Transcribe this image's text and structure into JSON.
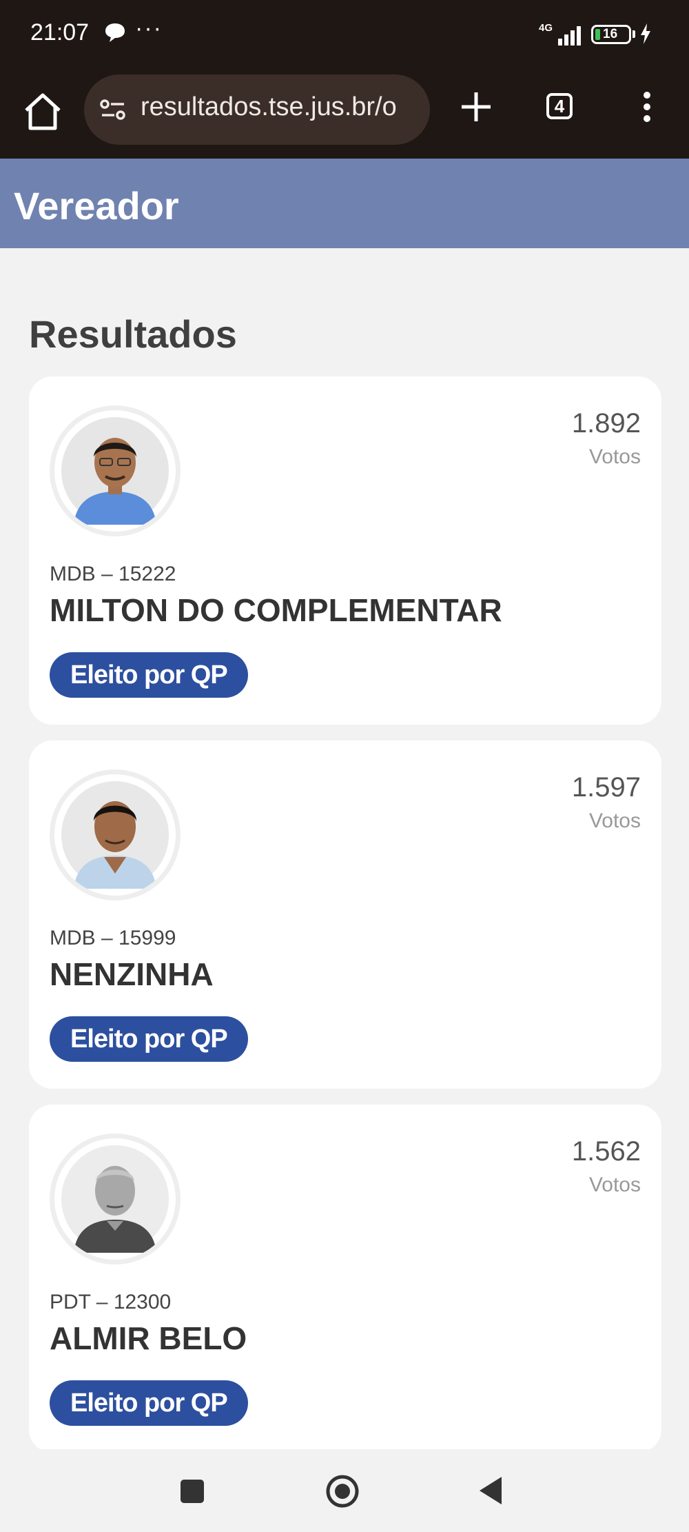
{
  "status_bar": {
    "time": "21:07",
    "network": "4G",
    "battery": "16"
  },
  "browser": {
    "url": "resultados.tse.jus.br/o",
    "tab_count": "4"
  },
  "page": {
    "header_title": "Vereador",
    "section_title": "Resultados"
  },
  "candidates": [
    {
      "votes": "1.892",
      "votes_label": "Votos",
      "party_number": "MDB – 15222",
      "name": "MILTON DO COMPLEMENTAR",
      "status": "Eleito por QP"
    },
    {
      "votes": "1.597",
      "votes_label": "Votos",
      "party_number": "MDB – 15999",
      "name": "NENZINHA",
      "status": "Eleito por QP"
    },
    {
      "votes": "1.562",
      "votes_label": "Votos",
      "party_number": "PDT – 12300",
      "name": "ALMIR BELO",
      "status": "Eleito por QP"
    }
  ],
  "colors": {
    "header_bg": "#7082b0",
    "badge_bg": "#2d4f9f",
    "chrome_bg": "#1e1714"
  },
  "icons": [
    "home-icon",
    "site-settings-icon",
    "plus-icon",
    "tabs-icon",
    "more-vert-icon",
    "nav-square-icon",
    "nav-home-icon",
    "nav-back-icon"
  ]
}
